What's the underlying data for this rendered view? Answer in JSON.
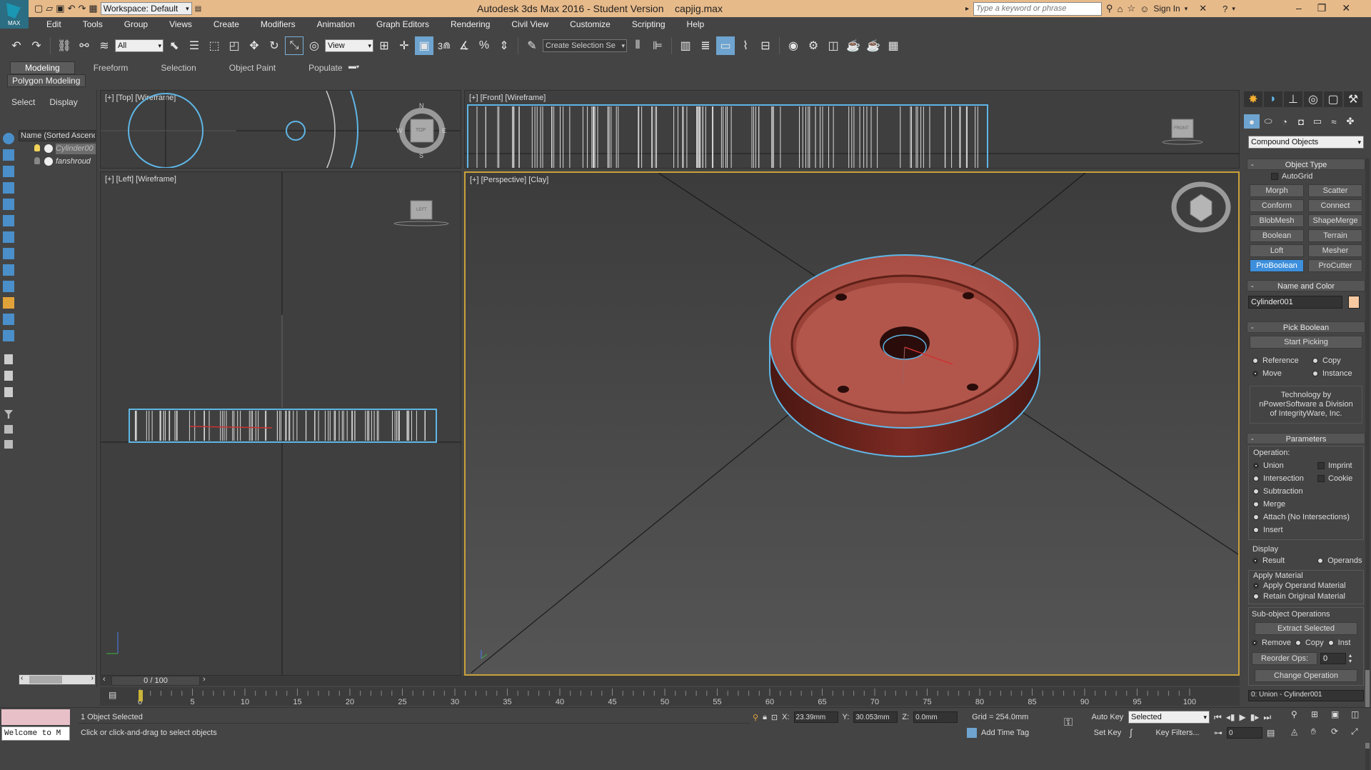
{
  "titlebar": {
    "workspace": "Workspace: Default",
    "title": "Autodesk 3ds Max 2016 - Student Version    capjig.max",
    "search_placeholder": "Type a keyword or phrase",
    "sign_in": "Sign In",
    "logo_text": "MAX"
  },
  "menu": [
    "Edit",
    "Tools",
    "Group",
    "Views",
    "Create",
    "Modifiers",
    "Animation",
    "Graph Editors",
    "Rendering",
    "Civil View",
    "Customize",
    "Scripting",
    "Help"
  ],
  "toolbar": {
    "filter": "All",
    "view": "View",
    "snap3": "3",
    "named_selection": "Create Selection Se"
  },
  "ribbon": {
    "tabs": [
      "Modeling",
      "Freeform",
      "Selection",
      "Object Paint",
      "Populate"
    ],
    "panel": "Polygon Modeling"
  },
  "scene_explorer": {
    "tabs": [
      "Select",
      "Display"
    ],
    "column": "Name (Sorted Ascend",
    "items": [
      "Cylinder00",
      "fanshroud"
    ]
  },
  "viewports": {
    "top": "[+] [Top] [Wireframe]",
    "front": "[+] [Front] [Wireframe]",
    "left": "[+] [Left] [Wireframe]",
    "perspective": "[+] [Perspective] [Clay]",
    "cube_top": "TOP",
    "cube_front": "FRONT",
    "cube_left": "LEFT",
    "compass": {
      "n": "N",
      "s": "S",
      "e": "E",
      "w": "W"
    }
  },
  "command_panel": {
    "category": "Compound Objects",
    "object_type": {
      "title": "Object Type",
      "autogrid": "AutoGrid",
      "buttons": [
        "Morph",
        "Scatter",
        "Conform",
        "Connect",
        "BlobMesh",
        "ShapeMerge",
        "Boolean",
        "Terrain",
        "Loft",
        "Mesher",
        "ProBoolean",
        "ProCutter"
      ],
      "active": "ProBoolean"
    },
    "name_color": {
      "title": "Name and Color",
      "name": "Cylinder001",
      "color": "#f6c9a0"
    },
    "pick_boolean": {
      "title": "Pick Boolean",
      "start": "Start Picking",
      "opts": [
        "Reference",
        "Copy",
        "Move",
        "Instance"
      ]
    },
    "tech_note": "Technology by nPowerSoftware a Division of IntegrityWare, Inc.",
    "parameters": {
      "title": "Parameters",
      "operation_label": "Operation:",
      "ops": [
        "Union",
        "Intersection",
        "Subtraction",
        "Merge",
        "Attach (No Intersections)",
        "Insert"
      ],
      "checks": [
        "Imprint",
        "Cookie"
      ],
      "display_label": "Display",
      "display_opts": [
        "Result",
        "Operands"
      ],
      "apply_material_label": "Apply Material",
      "apply_opts": [
        "Apply Operand Material",
        "Retain Original Material"
      ],
      "subobj_label": "Sub-object Operations",
      "extract": "Extract Selected",
      "subobj_opts": [
        "Remove",
        "Copy",
        "Inst"
      ],
      "reorder": "Reorder Ops:",
      "reorder_val": "0",
      "change_op": "Change Operation",
      "list_item": "0: Union - Cylinder001"
    }
  },
  "timeline": {
    "frame": "0 / 100",
    "ticks": [
      "0",
      "5",
      "10",
      "15",
      "20",
      "25",
      "30",
      "35",
      "40",
      "45",
      "50",
      "55",
      "60",
      "65",
      "70",
      "75",
      "80",
      "85",
      "90",
      "95",
      "100"
    ]
  },
  "status": {
    "selected": "1 Object Selected",
    "prompt": "Click or click-and-drag to select objects",
    "maxscript": "Welcome to M",
    "x_label": "X:",
    "x": "23.39mm",
    "y_label": "Y:",
    "y": "30.053mm",
    "z_label": "Z:",
    "z": "0.0mm",
    "grid": "Grid = 254.0mm",
    "add_time_tag": "Add Time Tag",
    "auto_key": "Auto Key",
    "set_key": "Set Key",
    "key_mode": "Selected",
    "key_filters": "Key Filters...",
    "frame_val": "0"
  }
}
